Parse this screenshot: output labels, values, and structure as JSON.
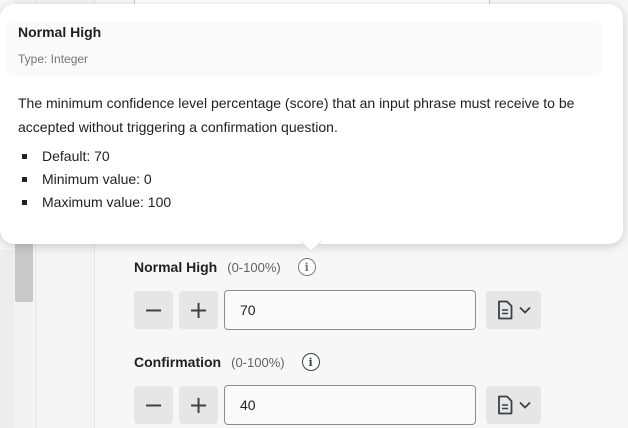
{
  "tooltip": {
    "title": "Normal High",
    "type": "Type: Integer",
    "description": "The minimum confidence level percentage (score) that an input phrase must receive to be accepted without triggering a confirmation question.",
    "items": [
      "Default: 70",
      "Minimum value: 0",
      "Maximum value: 100"
    ]
  },
  "fields": [
    {
      "label": "Normal High",
      "range": "(0-100%)",
      "value": "70",
      "minus": "−",
      "plus": "+"
    },
    {
      "label": "Confirmation",
      "range": "(0-100%)",
      "value": "40",
      "minus": "−",
      "plus": "+"
    }
  ],
  "icons": {
    "info": "i",
    "document": "document-icon",
    "chevron": "chevron-down-icon"
  }
}
